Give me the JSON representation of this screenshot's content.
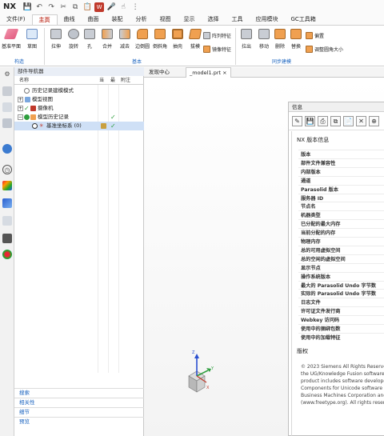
{
  "app": {
    "logo": "NX",
    "quick_access": [
      "save-icon",
      "undo-icon",
      "redo-icon",
      "cut-icon",
      "copy-icon",
      "paste-icon",
      "window-icon",
      "mic-icon",
      "touch-icon",
      "more-icon"
    ]
  },
  "menu": [
    "文件(F)",
    "主页",
    "曲线",
    "曲面",
    "装配",
    "分析",
    "视图",
    "显示",
    "选择",
    "工具",
    "应用模块",
    "GC工具箱"
  ],
  "ribbon": {
    "big": [
      "基准平面",
      "草图",
      "拉伸",
      "旋转",
      "孔",
      "合并",
      "减去",
      "边倒圆",
      "倒斜角",
      "抽壳",
      "拔模",
      "拉出",
      "移动",
      "删除",
      "替换"
    ],
    "small": [
      "阵列特征",
      "镜像特征",
      "偏置",
      "调整圆角大小"
    ],
    "groups": [
      "构造",
      "基本",
      "同步建模"
    ]
  },
  "navigator": {
    "title": "部件导航器",
    "columns": [
      "名称",
      "当",
      "最",
      "附注"
    ],
    "tree": [
      "历史记录建模模式",
      "模型视图",
      "摄像机",
      "模型历史记录",
      "基准坐标系 (0)"
    ],
    "sections": [
      "搜索",
      "相关性",
      "细节",
      "预览"
    ]
  },
  "tabs": [
    "发现中心",
    "_model1.prt"
  ],
  "info": {
    "title": "信息",
    "section1": "NX 版本信息",
    "fields": [
      "版本",
      "部件文件兼容性",
      "内部版本",
      "通道",
      "Parasolid 版本",
      "服务器 ID",
      "节点名",
      "机器类型",
      "已分配的最大内存",
      "当前分配的内存",
      "物理内存",
      "总的可用虚拟空间",
      "总的空闲的虚拟空间",
      "显示节点",
      "操作系统版本",
      "最大的 Parasolid Undo 字节数",
      "实际的 Parasolid Undo 字节数",
      "日志文件",
      "许可证文件发行商",
      "Webkey 访问码",
      "使用中的捆绑包数",
      "使用中的加载特征"
    ],
    "section2": "版权",
    "copyright": [
      "© 2023 Siemens All Rights Reserved. Th",
      "the UG/Knowledge Fusion software hav",
      "product includes software developed by",
      "Components for Unicode software provi",
      "Business Machines Corporation and oth",
      "(www.freetype.org). All rights reserved."
    ]
  },
  "colors": {
    "accent": "#c0392b",
    "link": "#1e66c0",
    "check": "#2e9e3e"
  }
}
